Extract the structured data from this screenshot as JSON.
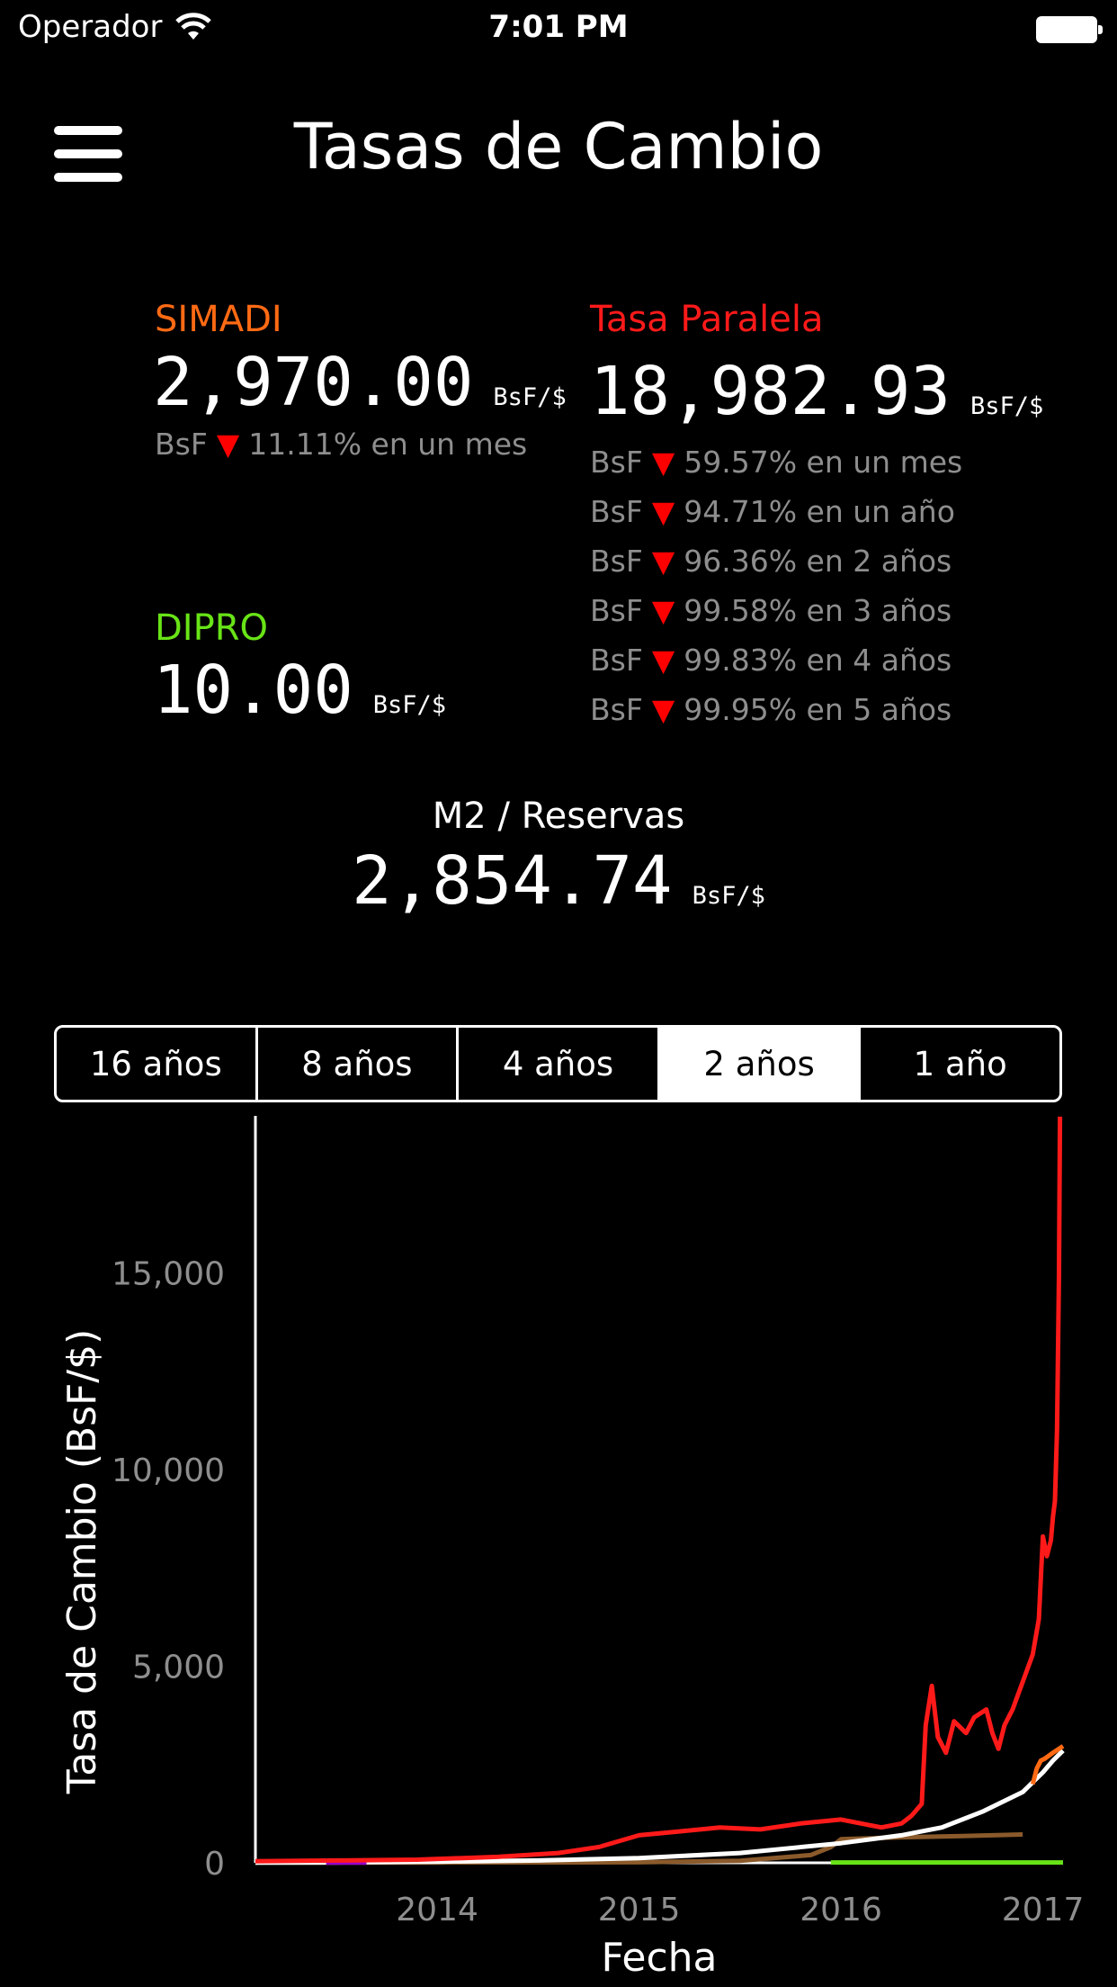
{
  "status_bar": {
    "carrier": "Operador",
    "time": "7:01 PM"
  },
  "header": {
    "title": "Tasas de Cambio"
  },
  "simadi": {
    "label": "SIMADI",
    "value": "2,970.00",
    "unit": "BsF/$",
    "change": {
      "prefix": "BsF",
      "arrow": "▼",
      "text": "11.11% en un mes"
    }
  },
  "paralela": {
    "label": "Tasa Paralela",
    "value": "18,982.93",
    "unit": "BsF/$",
    "changes": [
      {
        "prefix": "BsF",
        "arrow": "▼",
        "text": "59.57% en un mes"
      },
      {
        "prefix": "BsF",
        "arrow": "▼",
        "text": "94.71% en un año"
      },
      {
        "prefix": "BsF",
        "arrow": "▼",
        "text": "96.36% en 2 años"
      },
      {
        "prefix": "BsF",
        "arrow": "▼",
        "text": "99.58% en 3 años"
      },
      {
        "prefix": "BsF",
        "arrow": "▼",
        "text": "99.83% en 4 años"
      },
      {
        "prefix": "BsF",
        "arrow": "▼",
        "text": "99.95% en 5 años"
      }
    ]
  },
  "dipro": {
    "label": "DIPRO",
    "value": "10.00",
    "unit": "BsF/$"
  },
  "m2": {
    "label": "M2 / Reservas",
    "value": "2,854.74",
    "unit": "BsF/$"
  },
  "range_tabs": [
    {
      "label": "16 años",
      "active": false
    },
    {
      "label": "8 años",
      "active": false
    },
    {
      "label": "4 años",
      "active": false
    },
    {
      "label": "2 años",
      "active": true
    },
    {
      "label": "1 año",
      "active": false
    }
  ],
  "colors": {
    "simadi": "#ff6a13",
    "paralela": "#ff1a1a",
    "dipro": "#68e317",
    "m2": "#ffffff",
    "other": "#8b5a2b",
    "sicad": "#9900cc"
  },
  "chart_data": {
    "type": "line",
    "xlabel": "Fecha",
    "ylabel": "Tasa de Cambio (BsF/$)",
    "xlim": [
      2013.1,
      2017.1
    ],
    "ylim": [
      0,
      19000
    ],
    "x_ticks": [
      "2014",
      "2015",
      "2016",
      "2017"
    ],
    "y_ticks": [
      "0",
      "5,000",
      "10,000",
      "15,000"
    ],
    "grid": false,
    "series": [
      {
        "color": "#ff1a1a",
        "points": [
          [
            2013.1,
            40
          ],
          [
            2013.5,
            60
          ],
          [
            2013.9,
            80
          ],
          [
            2014.3,
            150
          ],
          [
            2014.6,
            250
          ],
          [
            2014.8,
            400
          ],
          [
            2015.0,
            700
          ],
          [
            2015.2,
            800
          ],
          [
            2015.4,
            900
          ],
          [
            2015.6,
            850
          ],
          [
            2015.8,
            1000
          ],
          [
            2016.0,
            1100
          ],
          [
            2016.2,
            900
          ],
          [
            2016.3,
            1000
          ],
          [
            2016.35,
            1200
          ],
          [
            2016.4,
            1500
          ],
          [
            2016.42,
            3500
          ],
          [
            2016.45,
            4500
          ],
          [
            2016.48,
            3200
          ],
          [
            2016.52,
            2800
          ],
          [
            2016.56,
            3600
          ],
          [
            2016.62,
            3300
          ],
          [
            2016.66,
            3700
          ],
          [
            2016.72,
            3900
          ],
          [
            2016.75,
            3300
          ],
          [
            2016.78,
            2900
          ],
          [
            2016.81,
            3500
          ],
          [
            2016.85,
            3900
          ],
          [
            2016.9,
            4600
          ],
          [
            2016.95,
            5300
          ],
          [
            2016.98,
            6200
          ],
          [
            2017.0,
            8300
          ],
          [
            2017.02,
            7800
          ],
          [
            2017.04,
            8200
          ],
          [
            2017.05,
            8800
          ],
          [
            2017.06,
            9200
          ],
          [
            2017.07,
            11000
          ],
          [
            2017.08,
            15000
          ],
          [
            2017.085,
            18982
          ]
        ]
      },
      {
        "color": "#ffffff",
        "points": [
          [
            2013.1,
            5
          ],
          [
            2013.5,
            10
          ],
          [
            2014.0,
            30
          ],
          [
            2014.5,
            60
          ],
          [
            2015.0,
            120
          ],
          [
            2015.5,
            250
          ],
          [
            2016.0,
            500
          ],
          [
            2016.3,
            700
          ],
          [
            2016.5,
            900
          ],
          [
            2016.7,
            1300
          ],
          [
            2016.9,
            1800
          ],
          [
            2017.0,
            2300
          ],
          [
            2017.05,
            2600
          ],
          [
            2017.1,
            2855
          ]
        ]
      },
      {
        "color": "#ff6a13",
        "points": [
          [
            2016.95,
            2000
          ],
          [
            2016.97,
            2400
          ],
          [
            2016.99,
            2600
          ],
          [
            2017.01,
            2650
          ],
          [
            2017.05,
            2800
          ],
          [
            2017.1,
            2970
          ]
        ]
      },
      {
        "color": "#8b5a2b",
        "points": [
          [
            2013.1,
            6
          ],
          [
            2014.0,
            6
          ],
          [
            2015.0,
            13
          ],
          [
            2015.5,
            50
          ],
          [
            2015.85,
            198
          ],
          [
            2015.95,
            400
          ],
          [
            2016.0,
            600
          ],
          [
            2016.3,
            650
          ],
          [
            2016.6,
            680
          ],
          [
            2016.9,
            720
          ]
        ]
      },
      {
        "color": "#68e317",
        "points": [
          [
            2015.95,
            10
          ],
          [
            2017.1,
            10
          ]
        ]
      },
      {
        "color": "#9900cc",
        "points": [
          [
            2013.45,
            6
          ],
          [
            2013.65,
            6
          ]
        ]
      }
    ]
  }
}
